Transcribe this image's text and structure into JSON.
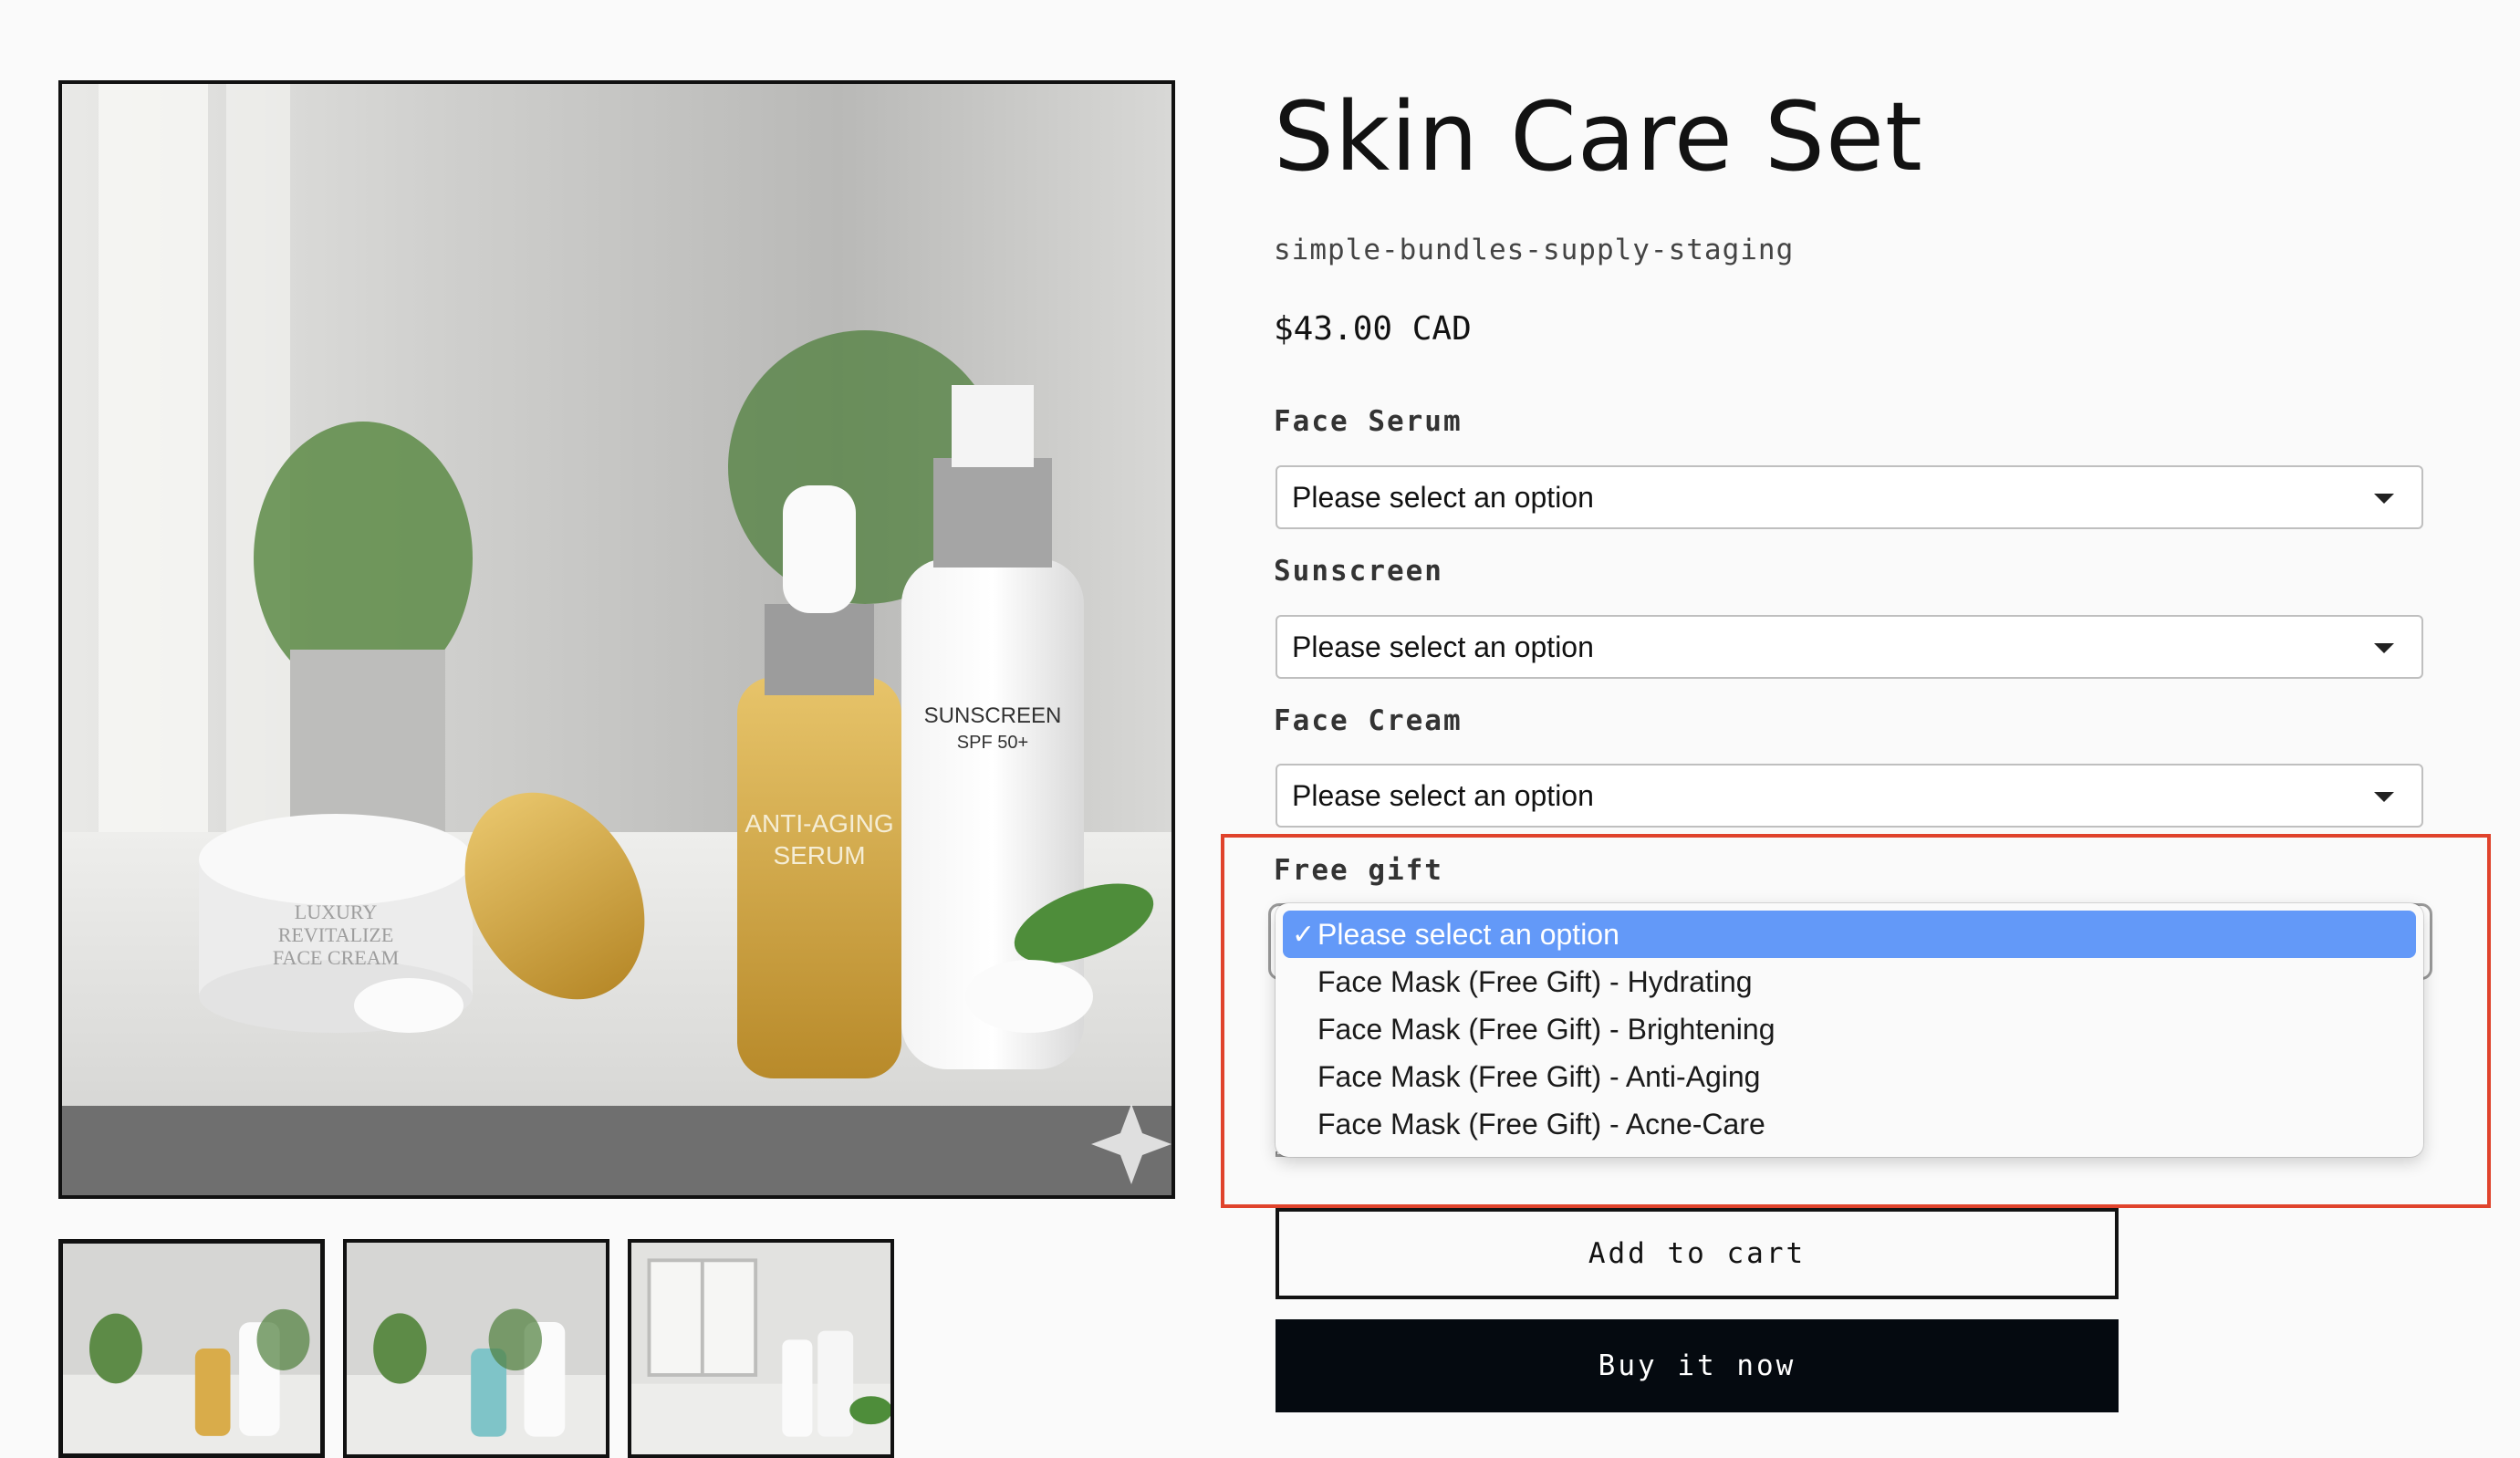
{
  "product": {
    "title": "Skin Care Set",
    "vendor": "simple-bundles-supply-staging",
    "price": "$43.00 CAD"
  },
  "gallery": {
    "main_image_text": {
      "sunscreen": "SUNSCREEN",
      "spf": "SPF 50+",
      "serum_line1": "ANTI-AGING",
      "serum_line2": "SERUM",
      "cream_line1": "LUXURY",
      "cream_line2": "REVITALIZE",
      "cream_line3": "FACE CREAM"
    },
    "thumbnails": 3
  },
  "options": {
    "face_serum": {
      "label": "Face Serum",
      "value": "Please select an option"
    },
    "sunscreen": {
      "label": "Sunscreen",
      "value": "Please select an option"
    },
    "face_cream": {
      "label": "Face Cream",
      "value": "Please select an option"
    },
    "free_gift": {
      "label": "Free gift",
      "value": "Please select an option",
      "items": [
        {
          "label": "Please select an option",
          "selected": true
        },
        {
          "label": "Face Mask (Free Gift) - Hydrating",
          "selected": false
        },
        {
          "label": "Face Mask (Free Gift) - Brightening",
          "selected": false
        },
        {
          "label": "Face Mask (Free Gift) - Anti-Aging",
          "selected": false
        },
        {
          "label": "Face Mask (Free Gift) - Acne-Care",
          "selected": false
        }
      ]
    }
  },
  "buttons": {
    "add_to_cart": "Add to cart",
    "buy_now": "Buy it now"
  },
  "colors": {
    "highlight_box": "#e0432c",
    "dropdown_selected": "#6399f8",
    "buy_button": "#050a10"
  }
}
